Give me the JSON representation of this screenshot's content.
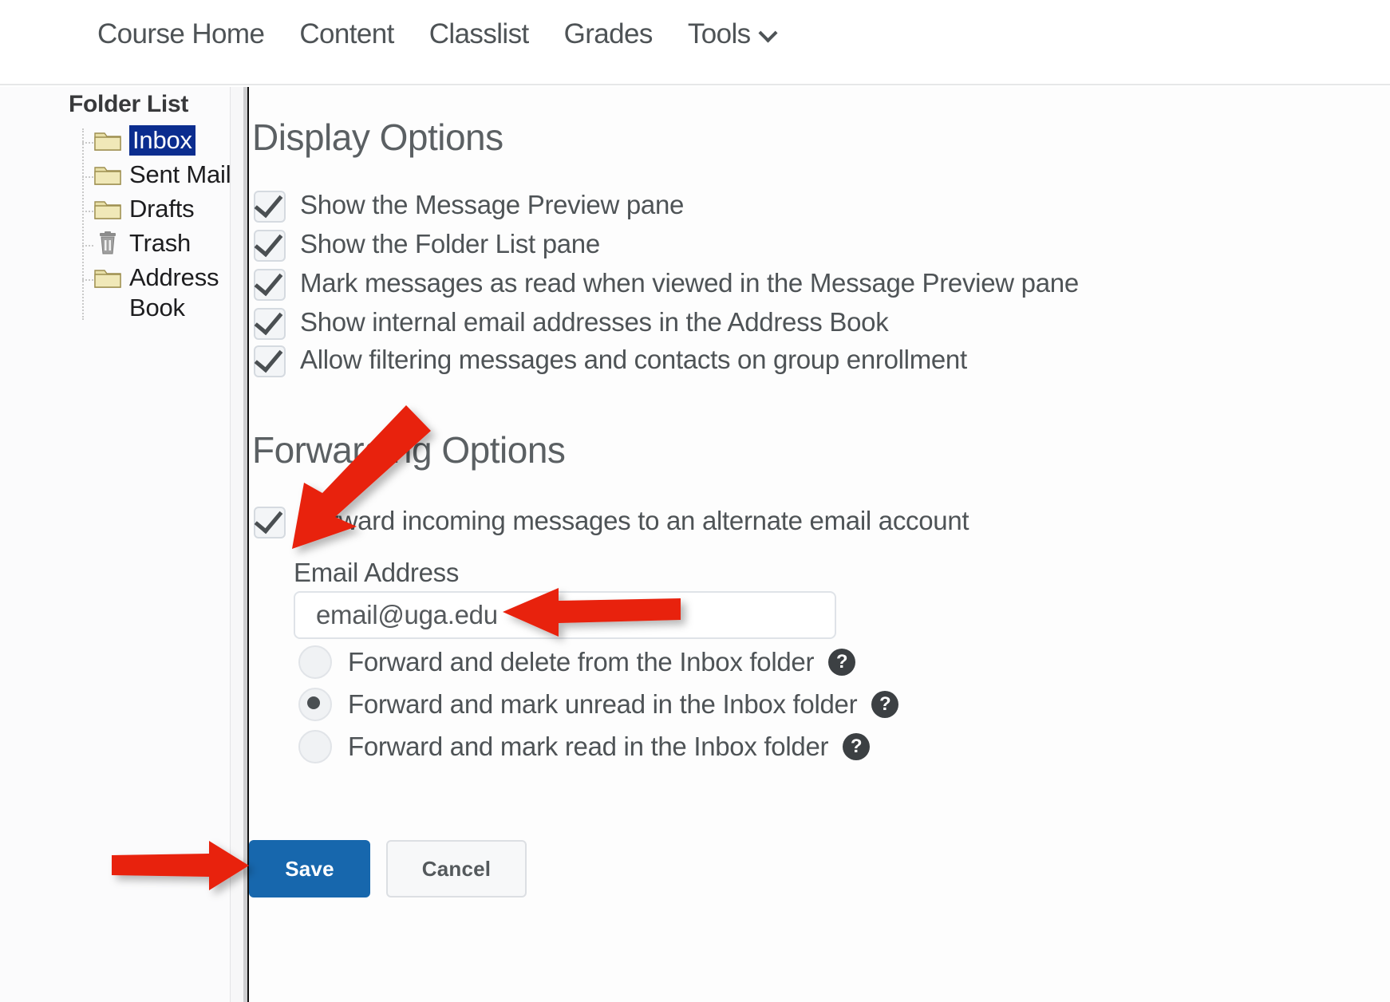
{
  "nav": {
    "items": [
      {
        "label": "Course Home",
        "name": "nav-course-home"
      },
      {
        "label": "Content",
        "name": "nav-content"
      },
      {
        "label": "Classlist",
        "name": "nav-classlist"
      },
      {
        "label": "Grades",
        "name": "nav-grades"
      },
      {
        "label": "Tools",
        "name": "nav-tools"
      }
    ],
    "tools_label": "Tools"
  },
  "sidebar": {
    "title": "Folder List",
    "items": [
      {
        "label": "Inbox",
        "icon": "folder-icon",
        "selected": true
      },
      {
        "label": "Sent Mail",
        "icon": "folder-icon",
        "selected": false
      },
      {
        "label": "Drafts",
        "icon": "folder-icon",
        "selected": false
      },
      {
        "label": "Trash",
        "icon": "trash-icon",
        "selected": false
      },
      {
        "label": "Address Book",
        "icon": "folder-icon",
        "selected": false
      }
    ]
  },
  "display_options": {
    "title": "Display Options",
    "checkboxes": [
      {
        "label": "Show the Message Preview pane",
        "checked": true
      },
      {
        "label": "Show the Folder List pane",
        "checked": true
      },
      {
        "label": "Mark messages as read when viewed in the Message Preview pane",
        "checked": true
      },
      {
        "label": "Show internal email addresses in the Address Book",
        "checked": true
      },
      {
        "label": "Allow filtering messages and contacts on group enrollment",
        "checked": true
      }
    ]
  },
  "forwarding_options": {
    "title": "Forwarding Options",
    "forward_checkbox": {
      "label": "Forward incoming messages to an alternate email account",
      "checked": true
    },
    "email_label": "Email Address",
    "email_value": "email@uga.edu",
    "email_placeholder": "Email Address",
    "radios": [
      {
        "label": "Forward and delete from the Inbox folder",
        "selected": false,
        "help": "?"
      },
      {
        "label": "Forward and mark unread in the Inbox folder",
        "selected": true,
        "help": "?"
      },
      {
        "label": "Forward and mark read in the Inbox folder",
        "selected": false,
        "help": "?"
      }
    ]
  },
  "buttons": {
    "save_label": "Save",
    "cancel_label": "Cancel"
  },
  "colors": {
    "save_blue": "#1767ad",
    "selection_navy": "#0b2d8f",
    "annotation_red": "#e8200e",
    "text_gray": "#4e5356"
  },
  "annotations": [
    {
      "name": "arrow-to-forward-checkbox",
      "direction": "down-left"
    },
    {
      "name": "arrow-to-email-field",
      "direction": "left"
    },
    {
      "name": "arrow-to-save-button",
      "direction": "right"
    }
  ]
}
